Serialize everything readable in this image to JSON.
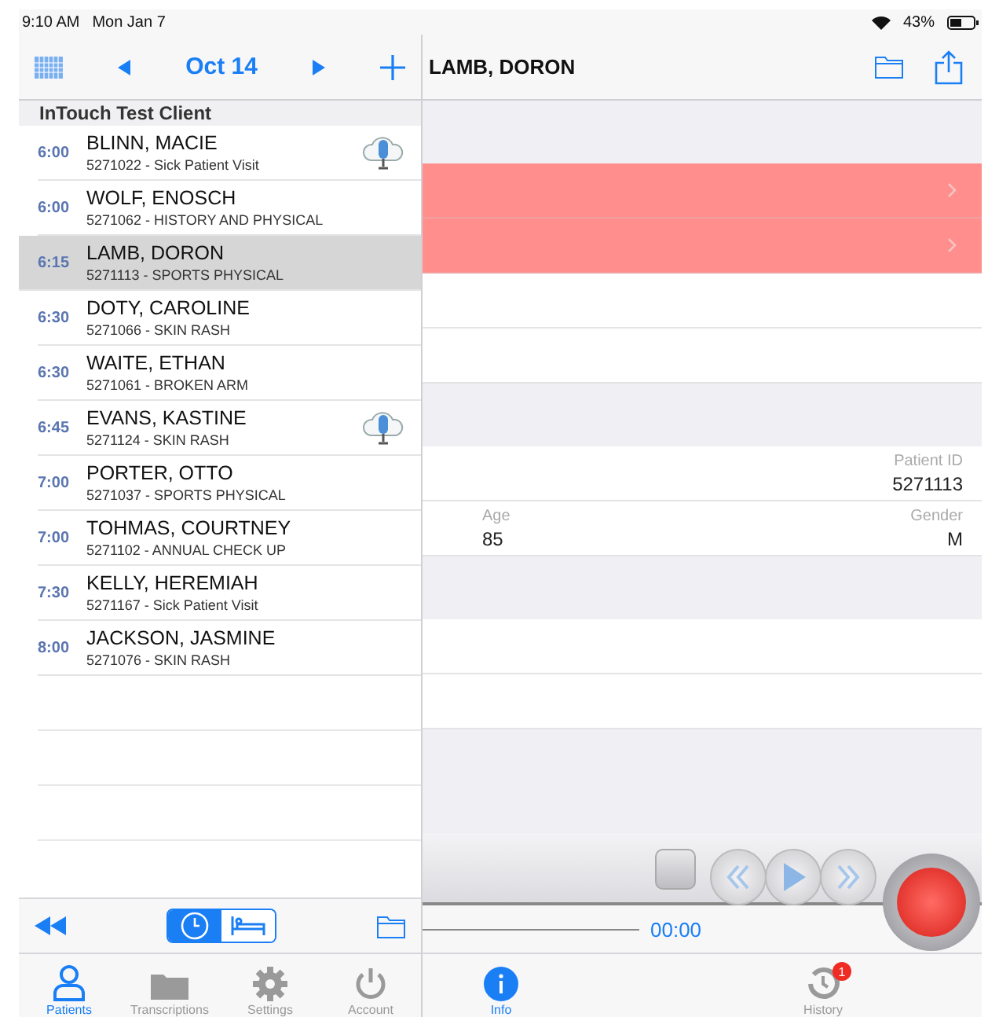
{
  "status_bar": {
    "time": "9:10 AM",
    "date": "Mon Jan 7",
    "battery": "43%"
  },
  "left_nav": {
    "title": "Oct 14"
  },
  "list": {
    "header": "InTouch Test Client",
    "rows": [
      {
        "time": "6:00",
        "name": "BLINN, MACIE",
        "detail": "5271022 - Sick Patient Visit",
        "has_audio": true,
        "selected": false
      },
      {
        "time": "6:00",
        "name": "WOLF, ENOSCH",
        "detail": "5271062 - HISTORY AND PHYSICAL",
        "has_audio": false,
        "selected": false
      },
      {
        "time": "6:15",
        "name": "LAMB, DORON",
        "detail": "5271113 - SPORTS PHYSICAL",
        "has_audio": false,
        "selected": true
      },
      {
        "time": "6:30",
        "name": "DOTY, CAROLINE",
        "detail": "5271066 - SKIN RASH",
        "has_audio": false,
        "selected": false
      },
      {
        "time": "6:30",
        "name": "WAITE, ETHAN",
        "detail": "5271061 - BROKEN ARM",
        "has_audio": false,
        "selected": false
      },
      {
        "time": "6:45",
        "name": "EVANS, KASTINE",
        "detail": "5271124 - SKIN RASH",
        "has_audio": true,
        "selected": false
      },
      {
        "time": "7:00",
        "name": "PORTER, OTTO",
        "detail": "5271037 - SPORTS PHYSICAL",
        "has_audio": false,
        "selected": false
      },
      {
        "time": "7:00",
        "name": "TOHMAS, COURTNEY",
        "detail": "5271102 - ANNUAL CHECK UP",
        "has_audio": false,
        "selected": false
      },
      {
        "time": "7:30",
        "name": "KELLY, HEREMIAH",
        "detail": "5271167 - Sick Patient Visit",
        "has_audio": false,
        "selected": false
      },
      {
        "time": "8:00",
        "name": "JACKSON, JASMINE",
        "detail": "5271076 - SKIN RASH",
        "has_audio": false,
        "selected": false
      }
    ]
  },
  "view_toggle": [
    {
      "kind": "clock",
      "selected": true
    },
    {
      "kind": "bed",
      "selected": false
    }
  ],
  "left_tabs": [
    {
      "kind": "person",
      "label": "Patients",
      "selected": true
    },
    {
      "kind": "folder",
      "label": "Transcriptions",
      "selected": false
    },
    {
      "kind": "gear",
      "label": "Settings",
      "selected": false
    },
    {
      "kind": "power",
      "label": "Account",
      "selected": false
    }
  ],
  "detail": {
    "title": "LAMB, DORON",
    "rows": [
      {
        "kind": "group"
      },
      {
        "kind": "alert"
      },
      {
        "kind": "alert"
      },
      {
        "kind": "blank"
      },
      {
        "kind": "blank"
      },
      {
        "kind": "group"
      },
      {
        "kind": "fields",
        "fields": [
          {
            "label": "Patient ID",
            "value": "5271113"
          }
        ]
      },
      {
        "kind": "fields",
        "fields": [
          {
            "label": "Age",
            "value": "85"
          },
          {
            "label": "Gender",
            "value": "M"
          }
        ]
      },
      {
        "kind": "group"
      },
      {
        "kind": "blank"
      },
      {
        "kind": "blank"
      }
    ]
  },
  "recorder": {
    "elapsed": "00:00"
  },
  "right_tabs": [
    {
      "kind": "info",
      "label": "Info",
      "selected": true
    },
    {
      "kind": "history",
      "label": "History",
      "selected": false,
      "badge": "1"
    }
  ]
}
